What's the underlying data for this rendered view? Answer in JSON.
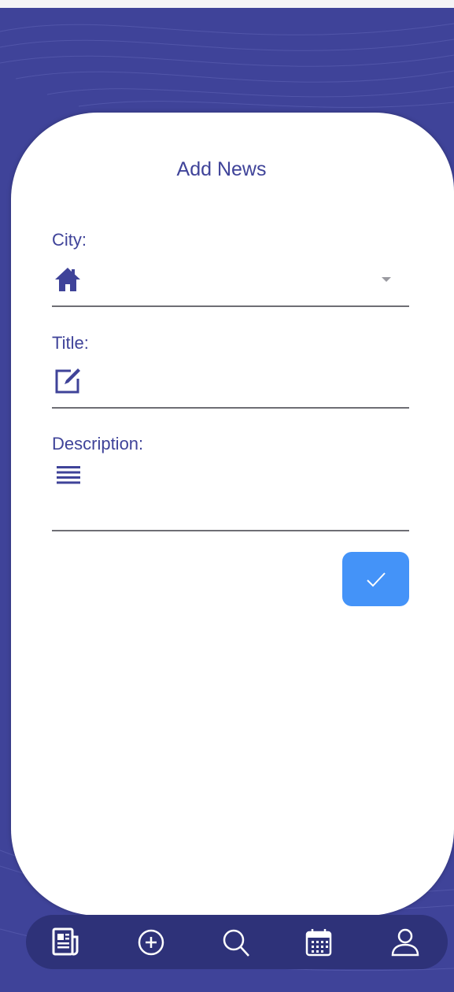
{
  "header": {
    "title": "Add News"
  },
  "form": {
    "city": {
      "label": "City:",
      "icon": "home-icon",
      "value": ""
    },
    "title": {
      "label": "Title:",
      "icon": "edit-icon",
      "value": ""
    },
    "description": {
      "label": "Description:",
      "icon": "text-lines-icon",
      "value": ""
    },
    "submit_icon": "check-icon"
  },
  "bottom_nav": {
    "items": [
      {
        "icon": "newspaper-icon"
      },
      {
        "icon": "add-circle-icon"
      },
      {
        "icon": "search-icon"
      },
      {
        "icon": "calendar-icon"
      },
      {
        "icon": "user-icon"
      }
    ]
  },
  "colors": {
    "background": "#3f4399",
    "accent": "#3f4399",
    "button": "#4493f8",
    "nav": "#2e3279"
  }
}
